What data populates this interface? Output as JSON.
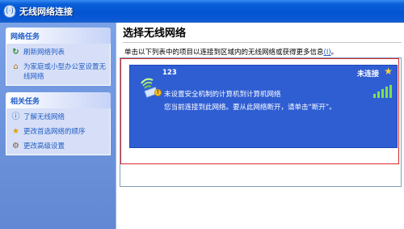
{
  "window": {
    "title": "无线网络连接",
    "icon": "wireless-network-icon"
  },
  "sidebar": {
    "panels": [
      {
        "header": "网络任务",
        "items": [
          {
            "label": "刷新网络列表",
            "icon": "refresh-icon"
          },
          {
            "label": "为家庭或小型办公室设置无线网络",
            "icon": "setup-network-icon"
          }
        ]
      },
      {
        "header": "相关任务",
        "items": [
          {
            "label": "了解无线网络",
            "icon": "info-icon"
          },
          {
            "label": "更改首选网络的顺序",
            "icon": "star-icon"
          },
          {
            "label": "更改高级设置",
            "icon": "advanced-settings-icon"
          }
        ]
      }
    ]
  },
  "main": {
    "title": "选择无线网络",
    "description": "单击以下列表中的项目以连接到区域内的无线网络或获得更多信息",
    "help_link": "(I)",
    "description_end": "。",
    "networks": [
      {
        "name": "123",
        "status": "未连接",
        "security": "未设置安全机制的计算机到计算机网络",
        "hint": "您当前连接到此网络。要从此网络断开，请单击“断开”。",
        "preferred": true,
        "signal_bars": 5,
        "signal_strength_active": 5
      }
    ]
  },
  "colors": {
    "titlebar": "#0454d2",
    "sidepane": "#6f96df",
    "selection": "#2f5ed3",
    "highlight_border": "#d62a2a",
    "link": "#215dc6"
  }
}
